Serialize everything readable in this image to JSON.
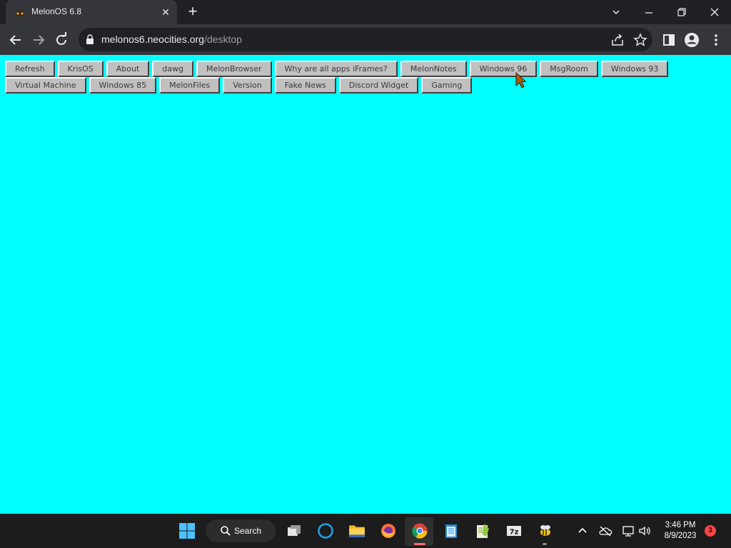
{
  "browser": {
    "tab_title": "MelonOS 6.8",
    "url_host": "melonos6.neocities.org",
    "url_path": "/desktop"
  },
  "desktop": {
    "background_color": "#00ffff",
    "apps": [
      {
        "label": "Refresh"
      },
      {
        "label": "KrisOS"
      },
      {
        "label": "About"
      },
      {
        "label": "dawg"
      },
      {
        "label": "MelonBrowser"
      },
      {
        "label": "Why are all apps iFrames?"
      },
      {
        "label": "MelonNotes"
      },
      {
        "label": "Windows 96"
      },
      {
        "label": "MsgRoom"
      },
      {
        "label": "Windows 93"
      },
      {
        "label": "Virtual Machine"
      },
      {
        "label": "Windows 85"
      },
      {
        "label": "MelonFiles"
      },
      {
        "label": "Version"
      },
      {
        "label": "Fake News"
      },
      {
        "label": "Discord Widget"
      },
      {
        "label": "Gaming"
      }
    ]
  },
  "taskbar": {
    "search_label": "Search",
    "clock_time": "3:46 PM",
    "clock_date": "8/9/2023",
    "notification_count": "3",
    "pinned": [
      {
        "name": "task-view-icon"
      },
      {
        "name": "cortana-icon"
      },
      {
        "name": "file-explorer-icon"
      },
      {
        "name": "firefox-icon"
      },
      {
        "name": "chrome-icon"
      },
      {
        "name": "notepad-icon"
      },
      {
        "name": "notepad-plus-plus-icon"
      },
      {
        "name": "7zip-icon"
      },
      {
        "name": "bee-app-icon"
      }
    ]
  }
}
